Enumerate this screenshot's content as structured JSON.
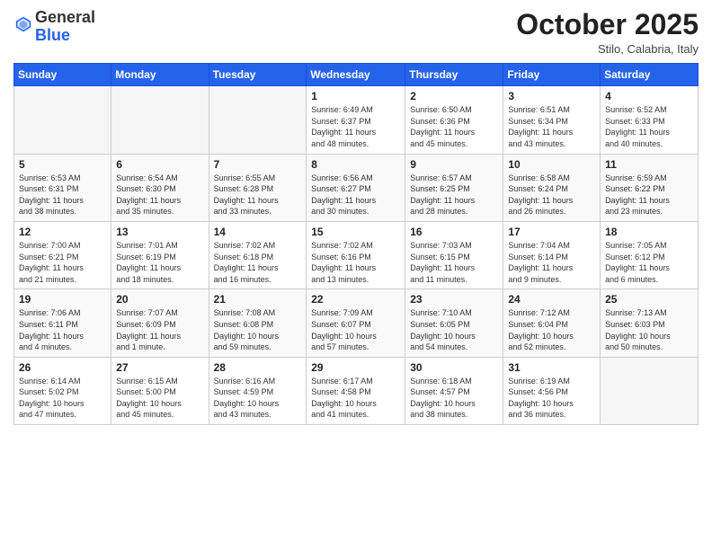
{
  "header": {
    "logo_general": "General",
    "logo_blue": "Blue",
    "month": "October 2025",
    "location": "Stilo, Calabria, Italy"
  },
  "weekdays": [
    "Sunday",
    "Monday",
    "Tuesday",
    "Wednesday",
    "Thursday",
    "Friday",
    "Saturday"
  ],
  "weeks": [
    [
      {
        "day": "",
        "info": ""
      },
      {
        "day": "",
        "info": ""
      },
      {
        "day": "",
        "info": ""
      },
      {
        "day": "1",
        "info": "Sunrise: 6:49 AM\nSunset: 6:37 PM\nDaylight: 11 hours\nand 48 minutes."
      },
      {
        "day": "2",
        "info": "Sunrise: 6:50 AM\nSunset: 6:36 PM\nDaylight: 11 hours\nand 45 minutes."
      },
      {
        "day": "3",
        "info": "Sunrise: 6:51 AM\nSunset: 6:34 PM\nDaylight: 11 hours\nand 43 minutes."
      },
      {
        "day": "4",
        "info": "Sunrise: 6:52 AM\nSunset: 6:33 PM\nDaylight: 11 hours\nand 40 minutes."
      }
    ],
    [
      {
        "day": "5",
        "info": "Sunrise: 6:53 AM\nSunset: 6:31 PM\nDaylight: 11 hours\nand 38 minutes."
      },
      {
        "day": "6",
        "info": "Sunrise: 6:54 AM\nSunset: 6:30 PM\nDaylight: 11 hours\nand 35 minutes."
      },
      {
        "day": "7",
        "info": "Sunrise: 6:55 AM\nSunset: 6:28 PM\nDaylight: 11 hours\nand 33 minutes."
      },
      {
        "day": "8",
        "info": "Sunrise: 6:56 AM\nSunset: 6:27 PM\nDaylight: 11 hours\nand 30 minutes."
      },
      {
        "day": "9",
        "info": "Sunrise: 6:57 AM\nSunset: 6:25 PM\nDaylight: 11 hours\nand 28 minutes."
      },
      {
        "day": "10",
        "info": "Sunrise: 6:58 AM\nSunset: 6:24 PM\nDaylight: 11 hours\nand 26 minutes."
      },
      {
        "day": "11",
        "info": "Sunrise: 6:59 AM\nSunset: 6:22 PM\nDaylight: 11 hours\nand 23 minutes."
      }
    ],
    [
      {
        "day": "12",
        "info": "Sunrise: 7:00 AM\nSunset: 6:21 PM\nDaylight: 11 hours\nand 21 minutes."
      },
      {
        "day": "13",
        "info": "Sunrise: 7:01 AM\nSunset: 6:19 PM\nDaylight: 11 hours\nand 18 minutes."
      },
      {
        "day": "14",
        "info": "Sunrise: 7:02 AM\nSunset: 6:18 PM\nDaylight: 11 hours\nand 16 minutes."
      },
      {
        "day": "15",
        "info": "Sunrise: 7:02 AM\nSunset: 6:16 PM\nDaylight: 11 hours\nand 13 minutes."
      },
      {
        "day": "16",
        "info": "Sunrise: 7:03 AM\nSunset: 6:15 PM\nDaylight: 11 hours\nand 11 minutes."
      },
      {
        "day": "17",
        "info": "Sunrise: 7:04 AM\nSunset: 6:14 PM\nDaylight: 11 hours\nand 9 minutes."
      },
      {
        "day": "18",
        "info": "Sunrise: 7:05 AM\nSunset: 6:12 PM\nDaylight: 11 hours\nand 6 minutes."
      }
    ],
    [
      {
        "day": "19",
        "info": "Sunrise: 7:06 AM\nSunset: 6:11 PM\nDaylight: 11 hours\nand 4 minutes."
      },
      {
        "day": "20",
        "info": "Sunrise: 7:07 AM\nSunset: 6:09 PM\nDaylight: 11 hours\nand 1 minute."
      },
      {
        "day": "21",
        "info": "Sunrise: 7:08 AM\nSunset: 6:08 PM\nDaylight: 10 hours\nand 59 minutes."
      },
      {
        "day": "22",
        "info": "Sunrise: 7:09 AM\nSunset: 6:07 PM\nDaylight: 10 hours\nand 57 minutes."
      },
      {
        "day": "23",
        "info": "Sunrise: 7:10 AM\nSunset: 6:05 PM\nDaylight: 10 hours\nand 54 minutes."
      },
      {
        "day": "24",
        "info": "Sunrise: 7:12 AM\nSunset: 6:04 PM\nDaylight: 10 hours\nand 52 minutes."
      },
      {
        "day": "25",
        "info": "Sunrise: 7:13 AM\nSunset: 6:03 PM\nDaylight: 10 hours\nand 50 minutes."
      }
    ],
    [
      {
        "day": "26",
        "info": "Sunrise: 6:14 AM\nSunset: 5:02 PM\nDaylight: 10 hours\nand 47 minutes."
      },
      {
        "day": "27",
        "info": "Sunrise: 6:15 AM\nSunset: 5:00 PM\nDaylight: 10 hours\nand 45 minutes."
      },
      {
        "day": "28",
        "info": "Sunrise: 6:16 AM\nSunset: 4:59 PM\nDaylight: 10 hours\nand 43 minutes."
      },
      {
        "day": "29",
        "info": "Sunrise: 6:17 AM\nSunset: 4:58 PM\nDaylight: 10 hours\nand 41 minutes."
      },
      {
        "day": "30",
        "info": "Sunrise: 6:18 AM\nSunset: 4:57 PM\nDaylight: 10 hours\nand 38 minutes."
      },
      {
        "day": "31",
        "info": "Sunrise: 6:19 AM\nSunset: 4:56 PM\nDaylight: 10 hours\nand 36 minutes."
      },
      {
        "day": "",
        "info": ""
      }
    ]
  ]
}
